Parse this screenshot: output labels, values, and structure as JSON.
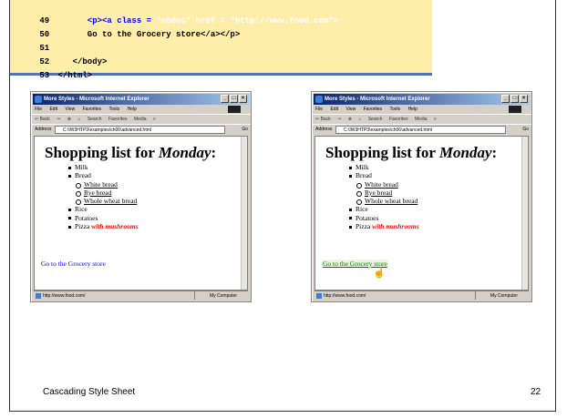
{
  "code_lines": [
    {
      "num": "49",
      "parts": [
        {
          "t": "      <p><a class = ",
          "c": "blue"
        },
        {
          "t": "\"nodec\" href = \"http://www.food.com\">",
          "c": "white"
        }
      ]
    },
    {
      "num": "50",
      "text": "      Go to the Grocery store</a></p>"
    },
    {
      "num": "51",
      "text": ""
    },
    {
      "num": "52",
      "text": "   </body>"
    },
    {
      "num": "53",
      "text": "</html>"
    }
  ],
  "windows": [
    {
      "title": "More Styles - Microsoft Internet Explorer",
      "menu": [
        "File",
        "Edit",
        "View",
        "Favorites",
        "Tools",
        "Help"
      ],
      "toolbar": [
        "⇐ Back",
        "⇒",
        "⊗",
        "⌂",
        "Search",
        "Favorites",
        "Media",
        "»"
      ],
      "address_label": "Address",
      "address_value": "C:\\IW3HTP3\\examples\\ch06\\advanced.html",
      "go_label": "Go",
      "heading_main": "Shopping list for ",
      "heading_italic": "Monday",
      "heading_end": ":",
      "items": [
        "Milk",
        "Bread"
      ],
      "subitems": [
        "White bread",
        "Rye bread",
        "Whole wheat bread"
      ],
      "items_after": [
        "Rice",
        "Potatoes"
      ],
      "pizza": "Pizza ",
      "pizza_extra": "with mushrooms",
      "link": "Go to the Grocery store",
      "status_url": "http://www.food.com/",
      "status_zone": "My Computer"
    },
    {
      "title": "More Styles - Microsoft Internet Explorer",
      "menu": [
        "File",
        "Edit",
        "View",
        "Favorites",
        "Tools",
        "Help"
      ],
      "toolbar": [
        "⇐ Back",
        "⇒",
        "⊗",
        "⌂",
        "Search",
        "Favorites",
        "Media",
        "»"
      ],
      "address_label": "Address",
      "address_value": "C:\\IW3HTP3\\examples\\ch06\\advanced.html",
      "go_label": "Go",
      "heading_main": "Shopping list for ",
      "heading_italic": "Monday",
      "heading_end": ":",
      "items": [
        "Milk",
        "Bread"
      ],
      "subitems": [
        "White bread",
        "Rye bread",
        "Whole wheat bread"
      ],
      "items_after": [
        "Rice",
        "Potatoes"
      ],
      "pizza": "Pizza ",
      "pizza_extra": "with mushrooms",
      "link": "Go to the Grocery store",
      "status_url": "http://www.food.com/",
      "status_zone": "My Computer"
    }
  ],
  "footer": {
    "title": "Cascading Style Sheet",
    "page": "22"
  },
  "colors": {
    "code_bg": "#ffeeaa",
    "code_keyword": "#0000ff",
    "accent_line": "#5670c0",
    "link": "#0000ee",
    "link_hover": "#008000",
    "mushrooms": "#ff0000"
  }
}
